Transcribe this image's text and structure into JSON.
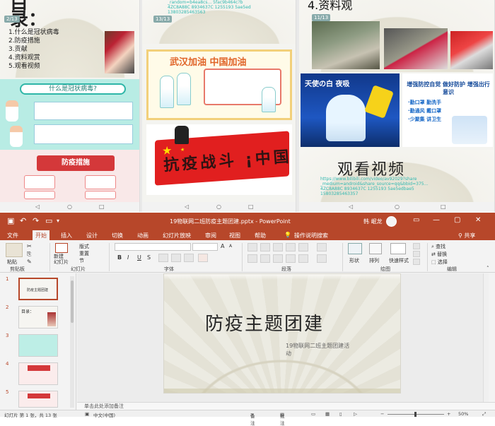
{
  "phones": {
    "phone1": {
      "toc_title": "目\n录：",
      "pager": "2/13",
      "toc_items": [
        "1.什么是冠状病毒",
        "2.防疫措施",
        "3.贡献",
        "4.资料观赏",
        "5.观看视频"
      ],
      "mid_banner": "什么是冠状病毒?",
      "bot_banner": "防疫措施",
      "nav": [
        "◁",
        "○",
        "□"
      ]
    },
    "phone2": {
      "pager": "13/13",
      "top_url": "_random=b4ea8cs... 5fac9b464c?b\n4ZC8A88C 8934637C 1255193 5ae5ed\n13803285463563",
      "cheer_title": "武汉加油  中国加油",
      "flag_text": "抗疫战斗 ¡中国",
      "nav": [
        "◁",
        "○",
        "□"
      ]
    },
    "phone3": {
      "pager": "11/13",
      "heading": "4.资料观",
      "poster1_text": "天使の白 夜吸",
      "poster2_title": "增强防控自觉 做好防护 增强出行意识",
      "poster2_rows": [
        "·勤口罩  勤洗手",
        "·勤通风  戴口罩",
        "·少聚集  讲卫生"
      ],
      "video_title": "观看视频",
      "video_url": "https://www.bilibili.com/video/av92029?share\n_medium=android&share_source=qq&bbid=375...\n4ZC8A88C 8934637C 1255193 5ae5edbae5\n15803285463357",
      "nav": [
        "◁",
        "○",
        "□"
      ]
    }
  },
  "ppt": {
    "window_title": "19物联网二班防疫主题团建.pptx - PowerPoint",
    "user_name": "韩 岷龙",
    "tabs": [
      "文件",
      "开始",
      "插入",
      "设计",
      "切换",
      "动画",
      "幻灯片放映",
      "审阅",
      "视图",
      "帮助"
    ],
    "active_tab": "开始",
    "tell_me": "操作说明搜索",
    "share": "共享",
    "ribbon": {
      "clipboard": {
        "label": "剪贴板",
        "paste": "粘贴"
      },
      "slides": {
        "label": "幻灯片",
        "new_slide": "新建\n幻灯片",
        "layout": "版式",
        "reset": "重置",
        "section": "节"
      },
      "font": {
        "label": "字体",
        "bold": "B",
        "italic": "I",
        "underline": "U",
        "strike": "S",
        "grow": "A",
        "shrink": "A"
      },
      "paragraph": {
        "label": "段落"
      },
      "drawing": {
        "label": "绘图",
        "shapes": "形状",
        "arrange": "排列",
        "quick_styles": "快速样式"
      },
      "editing": {
        "label": "编辑",
        "find": "查找",
        "replace": "替换",
        "select": "选择"
      }
    },
    "thumbnails": [
      {
        "num": "1",
        "text": "防疫主题团建"
      },
      {
        "num": "2",
        "text": "目录："
      },
      {
        "num": "3",
        "text": ""
      },
      {
        "num": "4",
        "text": ""
      },
      {
        "num": "5",
        "text": ""
      }
    ],
    "slide": {
      "title": "防疫主题团建",
      "subtitle": "19物联网二班主题团建活\n动"
    },
    "notes_placeholder": "单击此处添加备注",
    "status": {
      "slide_count": "幻灯片 第 1 张，共 13 张",
      "language": "中文(中国)",
      "notes": "备注",
      "comments": "批注",
      "zoom": "50%"
    },
    "colors": {
      "ppt_accent": "#b7472a"
    }
  }
}
